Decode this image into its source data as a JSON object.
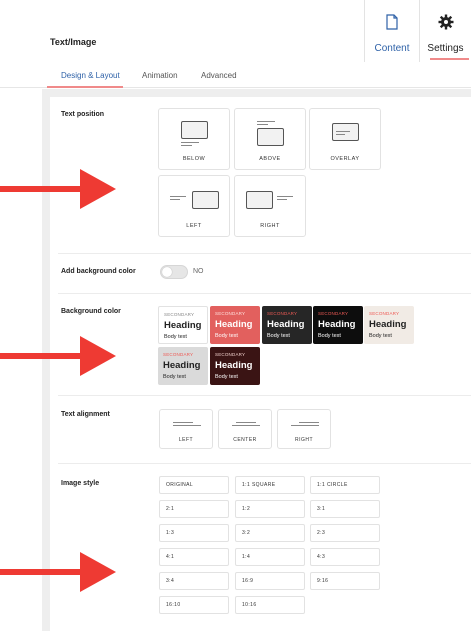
{
  "header": {
    "title": "Text/Image",
    "tabs": [
      {
        "label": "Content",
        "icon": "document-icon"
      },
      {
        "label": "Settings",
        "icon": "gear-icon"
      }
    ]
  },
  "subtabs": [
    "Design & Layout",
    "Animation",
    "Advanced"
  ],
  "text_position": {
    "label": "Text position",
    "options": [
      "BELOW",
      "ABOVE",
      "OVERLAY",
      "LEFT",
      "RIGHT"
    ]
  },
  "background_toggle": {
    "label": "Add background color",
    "state": "NO"
  },
  "background_color": {
    "label": "Background color",
    "swatches": [
      {
        "secondary": "SECONDARY",
        "heading": "Heading",
        "body": "Body text",
        "bg": "#ffffff",
        "fg": "#222222",
        "sec_color": "#888888"
      },
      {
        "secondary": "SECONDARY",
        "heading": "Heading",
        "body": "Body text",
        "bg": "#e2605e",
        "fg": "#ffffff",
        "sec_color": "#ffe0dd"
      },
      {
        "secondary": "SECONDARY",
        "heading": "Heading",
        "body": "Body text",
        "bg": "#262626",
        "fg": "#ffffff",
        "sec_color": "#ee5a55"
      },
      {
        "secondary": "SECONDARY",
        "heading": "Heading",
        "body": "Body text",
        "bg": "#0d0d0d",
        "fg": "#ffffff",
        "sec_color": "#ee5a55"
      },
      {
        "secondary": "SECONDARY",
        "heading": "Heading",
        "body": "Body text",
        "bg": "#f1ebe5",
        "fg": "#222222",
        "sec_color": "#ee5a55"
      },
      {
        "secondary": "SECONDARY",
        "heading": "Heading",
        "body": "Body text",
        "bg": "#dadada",
        "fg": "#222222",
        "sec_color": "#ee5a55"
      },
      {
        "secondary": "SECONDARY",
        "heading": "Heading",
        "body": "Body text",
        "bg": "#3a1414",
        "fg": "#ffffff",
        "sec_color": "#f0d0cc"
      }
    ]
  },
  "text_alignment": {
    "label": "Text alignment",
    "options": [
      "LEFT",
      "CENTER",
      "RIGHT"
    ]
  },
  "image_style": {
    "label": "Image style",
    "options": [
      "ORIGINAL",
      "1:1 SQUARE",
      "1:1 CIRCLE",
      "2:1",
      "1:2",
      "3:1",
      "1:3",
      "3:2",
      "2:3",
      "4:1",
      "1:4",
      "4:3",
      "3:4",
      "16:9",
      "9:16",
      "16:10",
      "10:16"
    ]
  },
  "colors": {
    "accent": "#2f62a8",
    "tab_underline": "#f08a8a",
    "annotation_arrow": "#ee3a33"
  }
}
